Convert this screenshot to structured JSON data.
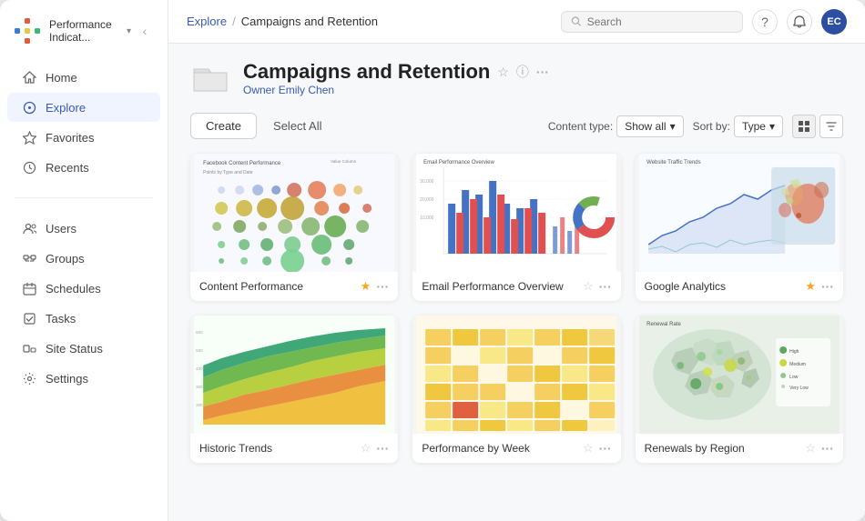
{
  "sidebar": {
    "logo_text": "Performance Indicat...",
    "chevron": "▾",
    "collapse_icon": "‹",
    "nav": [
      {
        "id": "home",
        "label": "Home",
        "icon": "home"
      },
      {
        "id": "explore",
        "label": "Explore",
        "icon": "explore",
        "active": true
      },
      {
        "id": "favorites",
        "label": "Favorites",
        "icon": "star"
      },
      {
        "id": "recents",
        "label": "Recents",
        "icon": "clock"
      }
    ],
    "admin": [
      {
        "id": "users",
        "label": "Users",
        "icon": "users"
      },
      {
        "id": "groups",
        "label": "Groups",
        "icon": "groups"
      },
      {
        "id": "schedules",
        "label": "Schedules",
        "icon": "schedules"
      },
      {
        "id": "tasks",
        "label": "Tasks",
        "icon": "tasks"
      },
      {
        "id": "site-status",
        "label": "Site Status",
        "icon": "site"
      },
      {
        "id": "settings",
        "label": "Settings",
        "icon": "gear"
      }
    ]
  },
  "topbar": {
    "breadcrumb_link": "Explore",
    "breadcrumb_sep": "/",
    "breadcrumb_current": "Campaigns and Retention",
    "search_placeholder": "Search",
    "avatar_initials": "EC"
  },
  "page": {
    "title": "Campaigns and Retention",
    "owner_label": "Owner",
    "owner_name": "Emily Chen"
  },
  "toolbar": {
    "create_label": "Create",
    "select_label": "Select All",
    "content_type_label": "Content type:",
    "content_type_value": "Show all",
    "sort_label": "Sort by:",
    "sort_value": "Type"
  },
  "cards": [
    {
      "id": "content-performance",
      "name": "Content Performance",
      "starred": true,
      "chart": "bubble"
    },
    {
      "id": "email-performance",
      "name": "Email Performance Overview",
      "starred": false,
      "chart": "bar-red"
    },
    {
      "id": "google-analytics",
      "name": "Google Analytics",
      "starred": true,
      "chart": "map-area"
    },
    {
      "id": "historic-trends",
      "name": "Historic Trends",
      "starred": false,
      "chart": "area-green"
    },
    {
      "id": "performance-week",
      "name": "Performance by Week",
      "starred": false,
      "chart": "heat"
    },
    {
      "id": "renewals-region",
      "name": "Renewals by Region",
      "starred": false,
      "chart": "geo"
    }
  ]
}
